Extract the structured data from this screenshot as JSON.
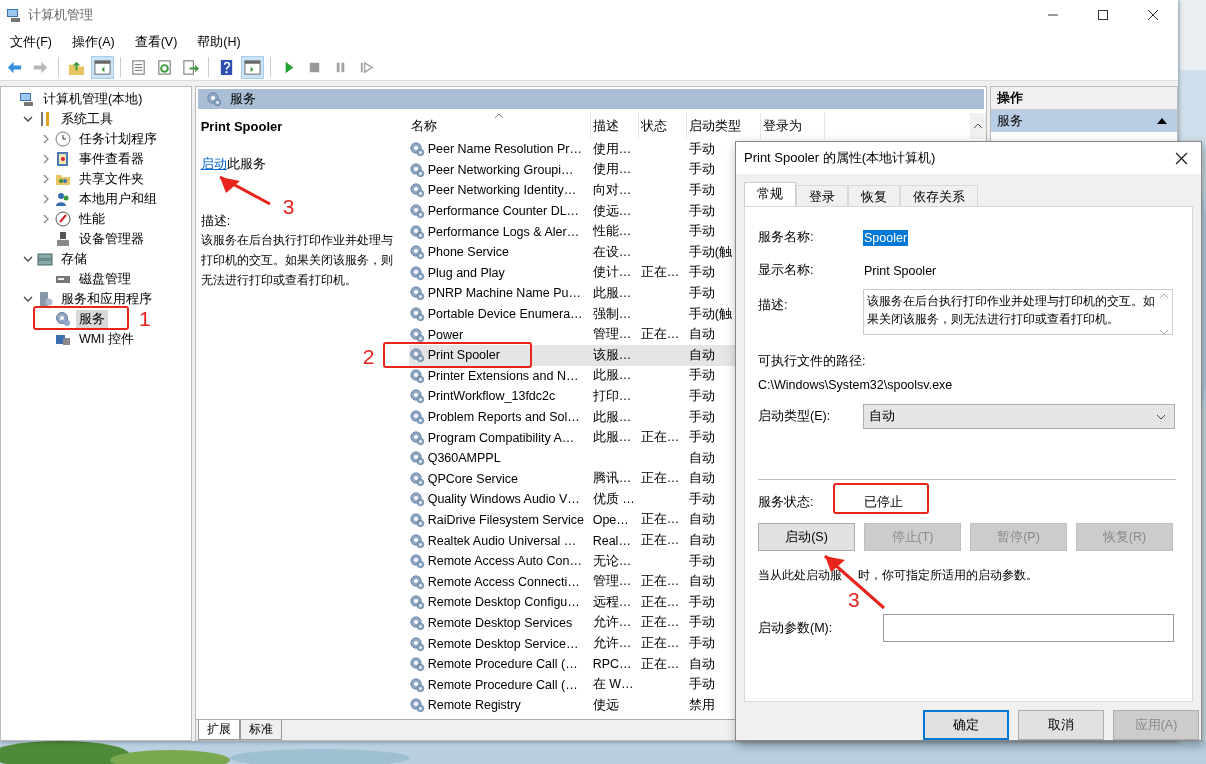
{
  "window": {
    "title": "计算机管理"
  },
  "menu": [
    "文件(F)",
    "操作(A)",
    "查看(V)",
    "帮助(H)"
  ],
  "toolbar": [
    [
      {
        "on": false,
        "disabled": false
      },
      {
        "on": false,
        "disabled": true
      }
    ],
    [
      {
        "on": false,
        "disabled": false
      },
      {
        "on": true,
        "disabled": false
      }
    ],
    [
      {
        "on": false,
        "disabled": false
      },
      {
        "on": false,
        "disabled": false
      },
      {
        "on": false,
        "disabled": false
      }
    ],
    [
      {
        "on": false,
        "disabled": false
      },
      {
        "on": true,
        "disabled": false
      }
    ],
    [
      {
        "on": false,
        "disabled": false
      },
      {
        "on": false,
        "disabled": true
      },
      {
        "on": false,
        "disabled": true
      },
      {
        "on": false,
        "disabled": true
      }
    ]
  ],
  "tree": [
    {
      "label": "计算机管理(本地)",
      "selected": false,
      "children": [
        {
          "label": "系统工具",
          "expanded": true,
          "selected": false,
          "children": [
            {
              "label": "任务计划程序",
              "expanded": false,
              "selected": false
            },
            {
              "label": "事件查看器",
              "expanded": false,
              "selected": false
            },
            {
              "label": "共享文件夹",
              "expanded": false,
              "selected": false
            },
            {
              "label": "本地用户和组",
              "expanded": false,
              "selected": false
            },
            {
              "label": "性能",
              "expanded": false,
              "selected": false
            },
            {
              "label": "设备管理器",
              "selected": false
            }
          ]
        },
        {
          "label": "存储",
          "expanded": true,
          "selected": false,
          "children": [
            {
              "label": "磁盘管理",
              "selected": false
            }
          ]
        },
        {
          "label": "服务和应用程序",
          "expanded": true,
          "selected": false,
          "children": [
            {
              "label": "服务",
              "selected": true,
              "boxed": true,
              "callout": "1"
            },
            {
              "label": "WMI 控件",
              "selected": false
            }
          ]
        }
      ]
    }
  ],
  "services_pane": {
    "header": "服务",
    "detail": {
      "title": "Print Spooler",
      "link": {
        "label": "启动",
        "callout": "3"
      },
      "link_suffix": "此服务",
      "description_label": "描述:",
      "description": "该服务在后台执行打印作业并处理与打印机的交互。如果关闭该服务，则无法进行打印或查看打印机。"
    },
    "table": {
      "columns": [
        {
          "label": "名称",
          "sorted": true
        },
        {
          "label": "描述",
          "sorted": false
        },
        {
          "label": "状态",
          "sorted": false
        },
        {
          "label": "启动类型",
          "sorted": false
        },
        {
          "label": "登录为",
          "sorted": false
        }
      ],
      "rows": [
        {
          "name": "Peer Name Resolution Pr…",
          "description": "使用…",
          "startup": "手动",
          "selected": false
        },
        {
          "name": "Peer Networking Groupi…",
          "description": "使用…",
          "startup": "手动",
          "selected": false
        },
        {
          "name": "Peer Networking Identity…",
          "description": "向对…",
          "startup": "手动",
          "selected": false
        },
        {
          "name": "Performance Counter DL…",
          "description": "使远…",
          "startup": "手动",
          "selected": false
        },
        {
          "name": "Performance Logs & Aler…",
          "description": "性能…",
          "startup": "手动",
          "selected": false
        },
        {
          "name": "Phone Service",
          "description": "在设…",
          "startup": "手动(触",
          "selected": false
        },
        {
          "name": "Plug and Play",
          "description": "使计…",
          "status": "正在…",
          "startup": "手动",
          "selected": false
        },
        {
          "name": "PNRP Machine Name Pu…",
          "description": "此服…",
          "startup": "手动",
          "selected": false
        },
        {
          "name": "Portable Device Enumera…",
          "description": "强制…",
          "startup": "手动(触",
          "selected": false
        },
        {
          "name": "Power",
          "description": "管理…",
          "status": "正在…",
          "startup": "自动",
          "selected": false
        },
        {
          "name": "Print Spooler",
          "description": "该服…",
          "startup": "自动",
          "selected": true,
          "boxed": true,
          "callout": "2"
        },
        {
          "name": "Printer Extensions and N…",
          "description": "此服…",
          "startup": "手动",
          "selected": false
        },
        {
          "name": "PrintWorkflow_13fdc2c",
          "description": "打印…",
          "startup": "手动",
          "selected": false
        },
        {
          "name": "Problem Reports and Sol…",
          "description": "此服…",
          "startup": "手动",
          "selected": false
        },
        {
          "name": "Program Compatibility A…",
          "description": "此服…",
          "status": "正在…",
          "startup": "手动",
          "selected": false
        },
        {
          "name": "Q360AMPPL",
          "startup": "自动",
          "selected": false
        },
        {
          "name": "QPCore Service",
          "description": "腾讯…",
          "status": "正在…",
          "startup": "自动",
          "selected": false
        },
        {
          "name": "Quality Windows Audio V…",
          "description": "优质 …",
          "startup": "手动",
          "selected": false
        },
        {
          "name": "RaiDrive Filesystem Service",
          "description": "Ope…",
          "status": "正在…",
          "startup": "自动",
          "selected": false
        },
        {
          "name": "Realtek Audio Universal …",
          "description": "Real…",
          "status": "正在…",
          "startup": "自动",
          "selected": false
        },
        {
          "name": "Remote Access Auto Con…",
          "description": "无论…",
          "startup": "手动",
          "selected": false
        },
        {
          "name": "Remote Access Connecti…",
          "description": "管理…",
          "status": "正在…",
          "startup": "自动",
          "selected": false
        },
        {
          "name": "Remote Desktop Configu…",
          "description": "远程…",
          "status": "正在…",
          "startup": "手动",
          "selected": false
        },
        {
          "name": "Remote Desktop Services",
          "description": "允许…",
          "status": "正在…",
          "startup": "手动",
          "selected": false
        },
        {
          "name": "Remote Desktop Service…",
          "description": "允许…",
          "status": "正在…",
          "startup": "手动",
          "selected": false
        },
        {
          "name": "Remote Procedure Call (…",
          "description": "RPC…",
          "status": "正在…",
          "startup": "自动",
          "selected": false
        },
        {
          "name": "Remote Procedure Call (…",
          "description": "在 W…",
          "startup": "手动",
          "selected": false
        },
        {
          "name": "Remote Registry",
          "description": "使远",
          "startup": "禁用",
          "selected": false
        }
      ]
    },
    "view_tabs": [
      {
        "label": "扩展",
        "selected": true
      },
      {
        "label": "标准",
        "selected": false
      }
    ]
  },
  "actions": {
    "title": "操作",
    "sections": [
      {
        "label": "服务",
        "expanded": true,
        "selected": true
      }
    ]
  },
  "dialog": {
    "title": "Print Spooler 的属性(本地计算机)",
    "tabs": [
      {
        "label": "常规",
        "selected": true
      },
      {
        "label": "登录",
        "selected": false
      },
      {
        "label": "恢复",
        "selected": false
      },
      {
        "label": "依存关系",
        "selected": false
      }
    ],
    "service_name": {
      "label": "服务名称:",
      "value": "Spooler",
      "selected": true
    },
    "display_name": {
      "label": "显示名称:",
      "value": "Print Spooler"
    },
    "description": {
      "label": "描述:",
      "value": "该服务在后台执行打印作业并处理与打印机的交互。如果关闭该服务，则无法进行打印或查看打印机。"
    },
    "path": {
      "label": "可执行文件的路径:",
      "value": "C:\\Windows\\System32\\spoolsv.exe"
    },
    "startup_type": {
      "label": "启动类型(E):",
      "value": "自动"
    },
    "status": {
      "label": "服务状态:",
      "value": "已停止",
      "boxed": true
    },
    "control_buttons": [
      {
        "label": "启动(S)",
        "disabled": false,
        "callout": "3"
      },
      {
        "label": "停止(T)",
        "disabled": true
      },
      {
        "label": "暂停(P)",
        "disabled": true
      },
      {
        "label": "恢复(R)",
        "disabled": true
      }
    ],
    "hint": [
      "当从此处启动服",
      "时，你可指定所适用的启动参数。"
    ],
    "start_parameters": {
      "label": "启动参数(M):"
    },
    "buttons": [
      {
        "label": "确定",
        "default": true,
        "disabled": false
      },
      {
        "label": "取消",
        "default": false,
        "disabled": false
      },
      {
        "label": "应用(A)",
        "default": false,
        "disabled": true
      }
    ]
  }
}
